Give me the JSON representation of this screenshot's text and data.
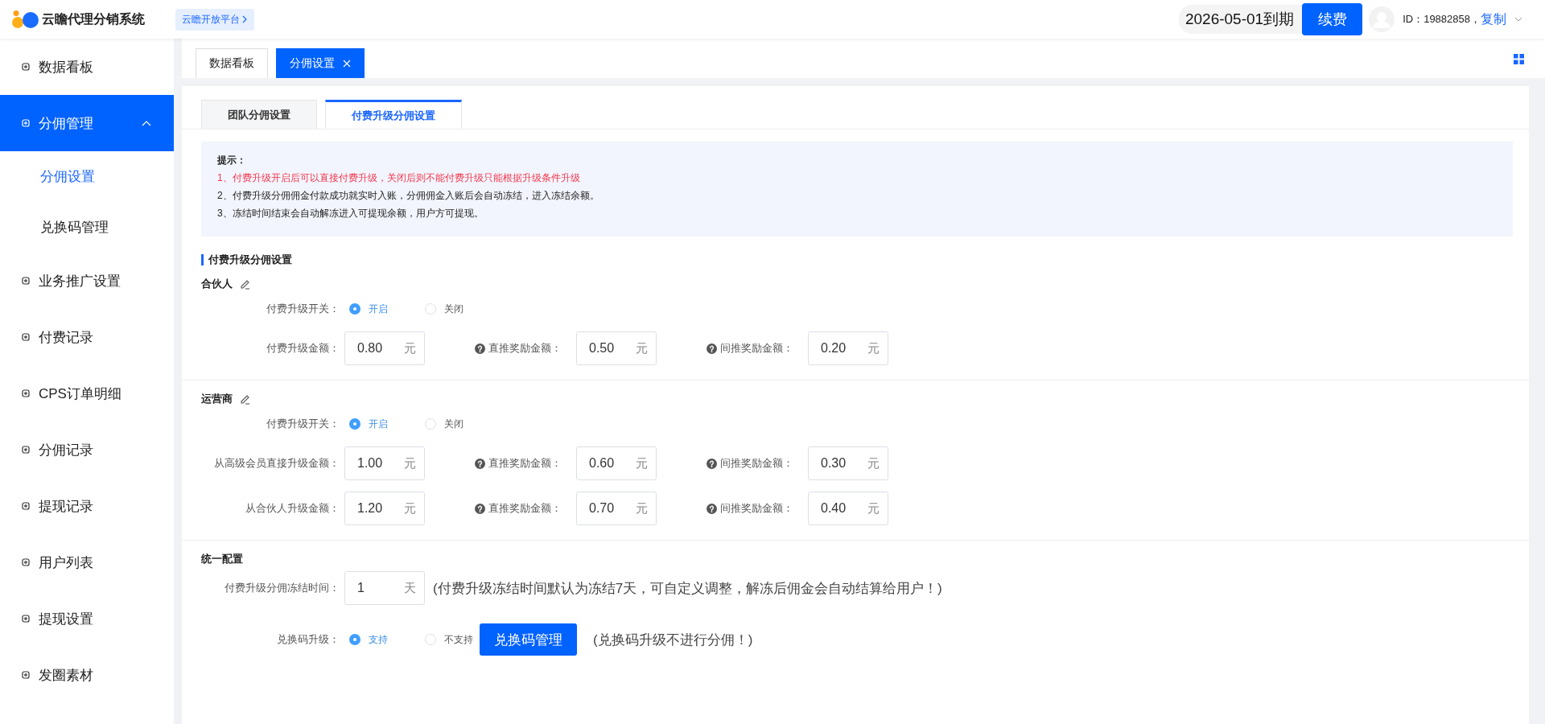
{
  "header": {
    "app_name": "云瞻代理分销系统",
    "platform_link": "云瞻开放平台",
    "expiry": "2026-05-01到期",
    "renew_button": "续费",
    "user_id": "ID：19882858，",
    "copy_link": "复制"
  },
  "sidebar": {
    "items": [
      {
        "label": "数据看板",
        "selected": false
      },
      {
        "label": "分佣管理",
        "selected": true,
        "expanded": true,
        "children": [
          {
            "label": "分佣设置",
            "selected": true
          },
          {
            "label": "兑换码管理",
            "selected": false
          }
        ]
      },
      {
        "label": "业务推广设置",
        "selected": false
      },
      {
        "label": "付费记录",
        "selected": false
      },
      {
        "label": "CPS订单明细",
        "selected": false
      },
      {
        "label": "分佣记录",
        "selected": false
      },
      {
        "label": "提现记录",
        "selected": false
      },
      {
        "label": "用户列表",
        "selected": false
      },
      {
        "label": "提现设置",
        "selected": false
      },
      {
        "label": "发圈素材",
        "selected": false
      }
    ]
  },
  "page_tabs": [
    {
      "label": "数据看板",
      "selected": false
    },
    {
      "label": "分佣设置",
      "selected": true,
      "closable": true
    }
  ],
  "settings_tabs": [
    {
      "label": "团队分佣设置",
      "selected": false
    },
    {
      "label": "付费升级分佣设置",
      "selected": true
    }
  ],
  "tips": {
    "title": "提示：",
    "lines": [
      {
        "text": "1、付费升级开启后可以直接付费升级，关闭后则不能付费升级只能根据升级条件升级",
        "kind": "warning"
      },
      {
        "text": "2、付费升级分佣佣金付款成功就实时入账，分佣佣金入账后会自动冻结，进入冻结余额。",
        "kind": "normal"
      },
      {
        "text": "3、冻结时间结束会自动解冻进入可提现余额，用户方可提现。",
        "kind": "normal"
      }
    ]
  },
  "section_title": "付费升级分佣设置",
  "groups": [
    {
      "title": "合伙人",
      "switch": {
        "label": "付费升级开关：",
        "options": [
          {
            "label": "开启",
            "selected": true
          },
          {
            "label": "关闭",
            "selected": false
          }
        ]
      },
      "rows": [
        [
          {
            "label": "付费升级金额：",
            "value": "0.80",
            "unit": "元"
          },
          {
            "label": "直推奖励金额：",
            "help": true,
            "value": "0.50",
            "unit": "元"
          },
          {
            "label": "间推奖励金额：",
            "help": true,
            "value": "0.20",
            "unit": "元"
          }
        ]
      ]
    },
    {
      "title": "运营商",
      "switch": {
        "label": "付费升级开关：",
        "options": [
          {
            "label": "开启",
            "selected": true
          },
          {
            "label": "关闭",
            "selected": false
          }
        ]
      },
      "rows": [
        [
          {
            "label": "从高级会员直接升级金额：",
            "value": "1.00",
            "unit": "元"
          },
          {
            "label": "直推奖励金额：",
            "help": true,
            "value": "0.60",
            "unit": "元"
          },
          {
            "label": "间推奖励金额：",
            "help": true,
            "value": "0.30",
            "unit": "元"
          }
        ],
        [
          {
            "label": "从合伙人升级金额：",
            "value": "1.20",
            "unit": "元"
          },
          {
            "label": "直推奖励金额：",
            "help": true,
            "value": "0.70",
            "unit": "元"
          },
          {
            "label": "间推奖励金额：",
            "help": true,
            "value": "0.40",
            "unit": "元"
          }
        ]
      ]
    }
  ],
  "unified": {
    "title": "统一配置",
    "freeze": {
      "label": "付费升级分佣冻结时间：",
      "value": "1",
      "unit": "天",
      "note": "(付费升级冻结时间默认为冻结7天，可自定义调整，解冻后佣金会自动结算给用户！)"
    },
    "redeem": {
      "label": "兑换码升级：",
      "options": [
        {
          "label": "支持",
          "selected": true
        },
        {
          "label": "不支持",
          "selected": false
        }
      ],
      "button": "兑换码管理",
      "note": "(兑换码升级不进行分佣！)"
    }
  }
}
